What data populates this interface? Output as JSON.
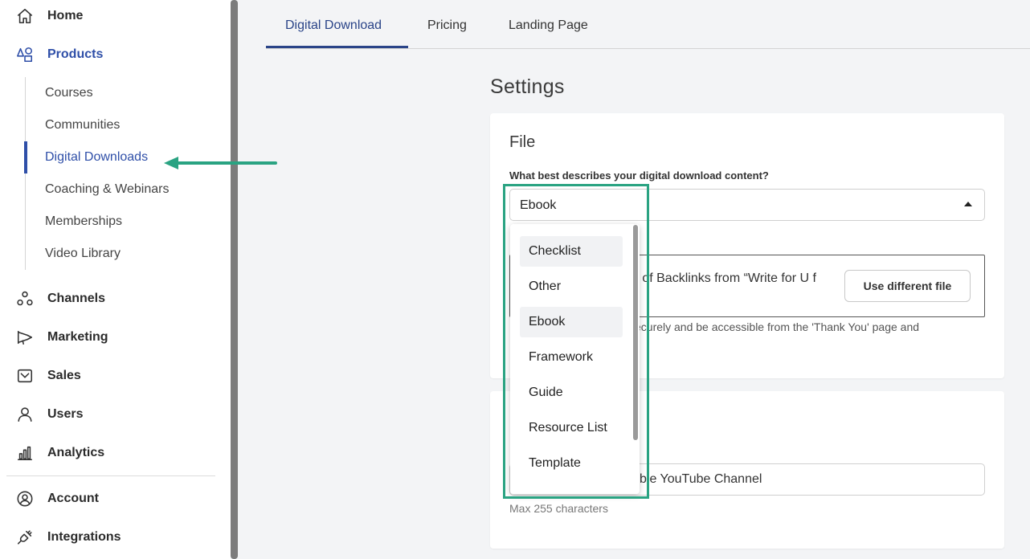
{
  "sidebar": {
    "home": "Home",
    "products": "Products",
    "sub_items": [
      "Courses",
      "Communities",
      "Digital Downloads",
      "Coaching & Webinars",
      "Memberships",
      "Video Library"
    ],
    "channels": "Channels",
    "marketing": "Marketing",
    "sales": "Sales",
    "users": "Users",
    "analytics": "Analytics",
    "account": "Account",
    "integrations": "Integrations"
  },
  "tabs": [
    "Digital Download",
    "Pricing",
    "Landing Page"
  ],
  "settings": {
    "title": "Settings",
    "file_heading": "File",
    "content_label": "What best describes your digital download content?",
    "selected_value": "Ebook",
    "file_name": "ns of Backlinks from “Write for U f",
    "use_different_file": "Use different file",
    "file_help": "ecurely and be accessible from the 'Thank You' page and",
    "title_input_value": "ble YouTube Channel",
    "max_chars": "Max 255 characters"
  },
  "dropdown": {
    "options": [
      "Checklist",
      "Other",
      "Ebook",
      "Framework",
      "Guide",
      "Resource List",
      "Template"
    ]
  },
  "colors": {
    "accent": "#2f4fa8",
    "annotation": "#2aa382"
  }
}
